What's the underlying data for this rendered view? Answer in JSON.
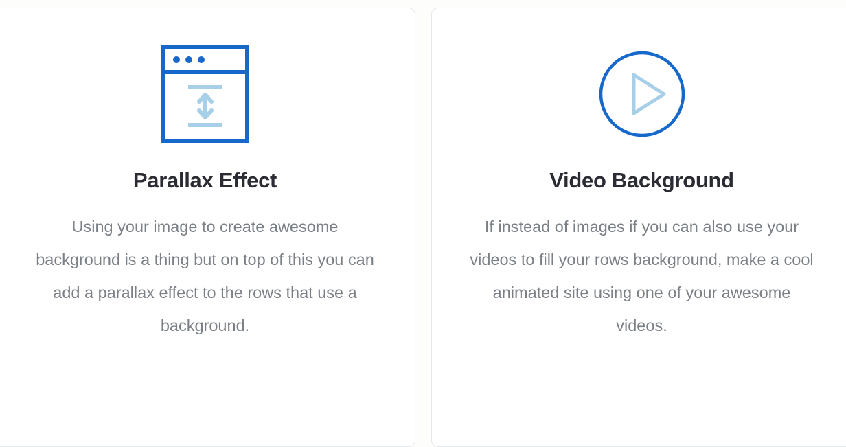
{
  "page": {
    "background_color": "#fdfdfc",
    "card_background": "#ffffff",
    "card_border_color": "#e6e9ec",
    "heading_color": "#2b2b33",
    "body_text_color": "#7b8086",
    "accent_blue": "#1668cb",
    "accent_light_blue": "#a8cfe8"
  },
  "cards": [
    {
      "icon": "browser-window-parallax-icon",
      "title": "Parallax Effect",
      "body": "Using your image to create awesome background is a thing but on top of this you can add a parallax effect to the rows that use a background."
    },
    {
      "icon": "play-circle-icon",
      "title": "Video Background",
      "body": "If instead of images if you can also use your videos to fill your rows background, make a cool animated site using one of your awesome videos."
    }
  ]
}
